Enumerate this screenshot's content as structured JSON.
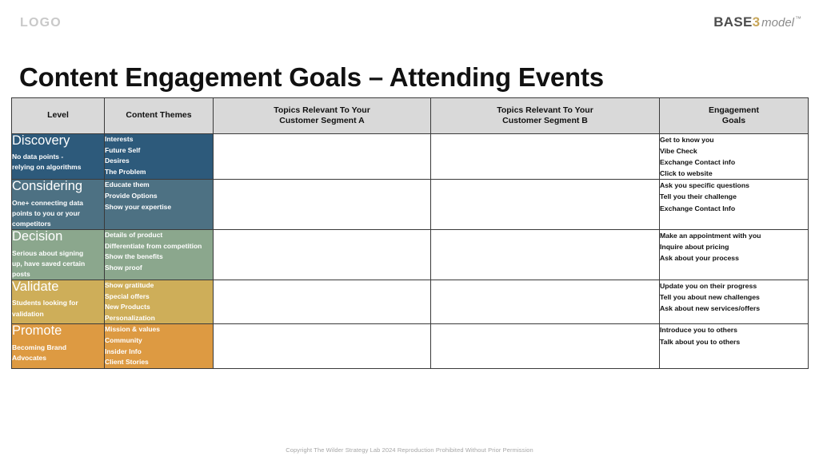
{
  "header": {
    "logo_placeholder": "LOGO",
    "brand": {
      "base": "BASE",
      "three": "3",
      "model": "model",
      "tm": "™",
      "base_color": "#4d4d4d",
      "three_color": "#c8a75b",
      "model_color": "#8c8c8c"
    },
    "title": "Content Engagement Goals – Attending Events"
  },
  "table": {
    "columns": [
      {
        "key": "level",
        "label": "Level"
      },
      {
        "key": "themes",
        "label": "Content Themes"
      },
      {
        "key": "segment_a",
        "label": "Topics Relevant To Your\nCustomer Segment A"
      },
      {
        "key": "segment_b",
        "label": "Topics Relevant To Your\nCustomer Segment B"
      },
      {
        "key": "goals",
        "label": "Engagement\nGoals"
      }
    ],
    "column_labels": {
      "level": "Level",
      "themes": "Content Themes",
      "segment_a_line1": "Topics Relevant To Your",
      "segment_a_line2": "Customer Segment A",
      "segment_b_line1": "Topics Relevant To Your",
      "segment_b_line2": "Customer Segment B",
      "goals_line1": "Engagement",
      "goals_line2": "Goals"
    },
    "rows": [
      {
        "id": "discovery",
        "level_name": "Discovery",
        "level_desc": "No data points  -\nrelying on algorithms",
        "level_desc_line1": "No data points  -",
        "level_desc_line2": "relying on algorithms",
        "color": "#2d5a7b",
        "themes": [
          "Interests",
          "Future Self",
          "Desires",
          "The Problem"
        ],
        "segment_a": "",
        "segment_b": "",
        "goals": [
          "Get to know you",
          "Vibe Check",
          "Exchange Contact info",
          "Click to website"
        ]
      },
      {
        "id": "considering",
        "level_name": "Considering",
        "level_desc": "One+ connecting data\npoints to you or your\ncompetitors",
        "level_desc_line1": "One+ connecting data",
        "level_desc_line2": "points to you or your",
        "level_desc_line3": "competitors",
        "color": "#4d7183",
        "themes": [
          "Educate them",
          "Provide Options",
          "Show your expertise"
        ],
        "segment_a": "",
        "segment_b": "",
        "goals": [
          "Ask you specific questions",
          "Tell you their challenge",
          "Exchange Contact Info"
        ]
      },
      {
        "id": "decision",
        "level_name": "Decision",
        "level_desc": "Serious about signing\nup, have saved certain\nposts",
        "level_desc_line1": "Serious about signing",
        "level_desc_line2": "up, have saved certain",
        "level_desc_line3": "posts",
        "color": "#8ba78d",
        "themes": [
          "Details of product",
          "Differentiate from competition",
          "Show the benefits",
          "Show proof"
        ],
        "segment_a": "",
        "segment_b": "",
        "goals": [
          "Make an appointment with you",
          "Inquire about pricing",
          "Ask about your process"
        ]
      },
      {
        "id": "validate",
        "level_name": "Validate",
        "level_desc": "Students looking for\nvalidation",
        "level_desc_line1": "Students looking for",
        "level_desc_line2": "validation",
        "color": "#ceae59",
        "themes": [
          "Show gratitude",
          "Special offers",
          "New Products",
          "Personalization"
        ],
        "segment_a": "",
        "segment_b": "",
        "goals": [
          "Update you on their progress",
          "Tell you about new challenges",
          "Ask about new services/offers"
        ]
      },
      {
        "id": "promote",
        "level_name": "Promote",
        "level_desc": "Becoming Brand\nAdvocates",
        "level_desc_line1": "Becoming Brand",
        "level_desc_line2": "Advocates",
        "color": "#dd9a42",
        "themes": [
          "Mission & values",
          "Community",
          "Insider Info",
          "Client Stories"
        ],
        "segment_a": "",
        "segment_b": "",
        "goals": [
          "Introduce you to others",
          "Talk about you to others"
        ]
      }
    ]
  },
  "footer": {
    "copyright": "Copyright The Wilder Strategy Lab 2024 Reproduction Prohibited Without Prior Permission"
  }
}
